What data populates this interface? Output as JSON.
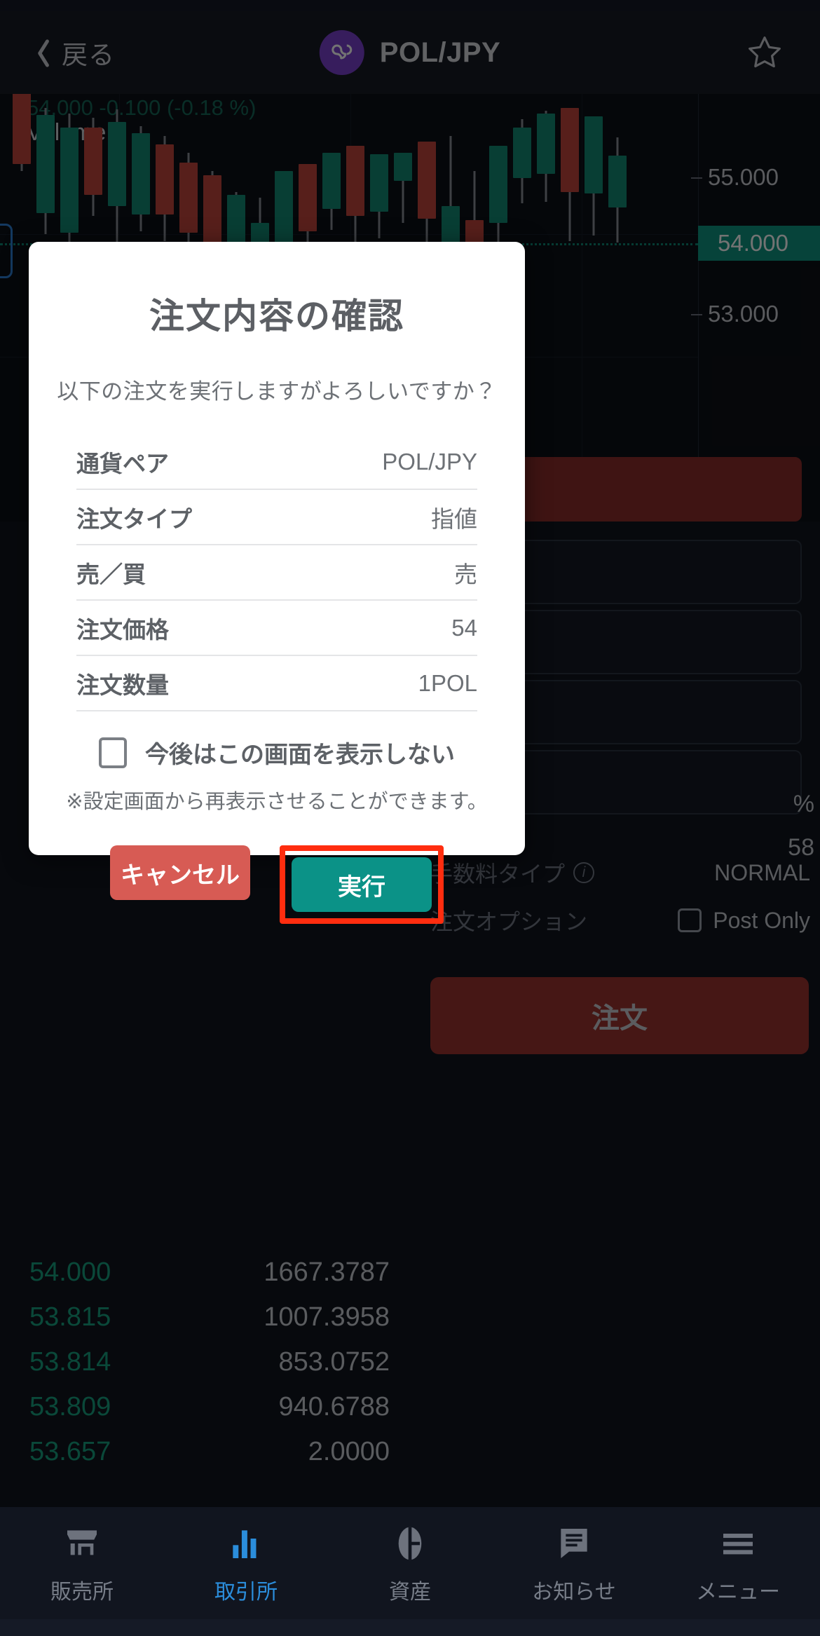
{
  "header": {
    "back_label": "戻る",
    "pair_title": "POL/JPY",
    "coin_icon": "polygon-logo-icon",
    "star_icon": "favorite-star-icon",
    "back_icon": "chevron-left-icon"
  },
  "chart": {
    "change_text": "54.000  -0.100 (-0.18 %)",
    "volume_label": "Volume",
    "price_ticks": [
      "55.000",
      "53.000"
    ],
    "current_price": "54.000",
    "axis_top": "55.000",
    "axis_bottom": "53.000"
  },
  "orderbook": {
    "rows": [
      {
        "price": "54.000",
        "amount": "1667.3787"
      },
      {
        "price": "53.815",
        "amount": "1007.3958"
      },
      {
        "price": "53.814",
        "amount": "853.0752"
      },
      {
        "price": "53.809",
        "amount": "940.6788"
      },
      {
        "price": "53.657",
        "amount": "2.0000"
      }
    ]
  },
  "order_form": {
    "percent_label": "%",
    "balance_fragment": "58",
    "fee_type_label": "手数料タイプ",
    "fee_type_value": "NORMAL",
    "fee_info_icon": "info-circle-icon",
    "order_option_label": "注文オプション",
    "post_only_label": "Post Only",
    "post_only_checkbox_icon": "checkbox-unchecked-icon",
    "submit_label": "注文"
  },
  "dialog": {
    "title": "注文内容の確認",
    "description": "以下の注文を実行しますがよろしいですか？",
    "rows": [
      {
        "label": "通貨ペア",
        "value": "POL/JPY"
      },
      {
        "label": "注文タイプ",
        "value": "指値"
      },
      {
        "label": "売／買",
        "value": "売"
      },
      {
        "label": "注文価格",
        "value": "54"
      },
      {
        "label": "注文数量",
        "value": "1POL"
      }
    ],
    "checkbox_label": "今後はこの画面を表示しない",
    "checkbox_icon": "checkbox-unchecked-icon",
    "note": "※設定画面から再表示させることができます。",
    "cancel_label": "キャンセル",
    "execute_label": "実行",
    "highlight_color": "#ff2d0f",
    "execute_color": "#0b9287",
    "cancel_color": "#d75b54"
  },
  "navbar": {
    "items": [
      {
        "label": "販売所",
        "icon": "storefront-icon",
        "active": false
      },
      {
        "label": "取引所",
        "icon": "bar-chart-icon",
        "active": true
      },
      {
        "label": "資産",
        "icon": "assets-coin-icon",
        "active": false
      },
      {
        "label": "お知らせ",
        "icon": "message-icon",
        "active": false
      },
      {
        "label": "メニュー",
        "icon": "hamburger-icon",
        "active": false
      }
    ],
    "active_color": "#2b8ddb"
  }
}
